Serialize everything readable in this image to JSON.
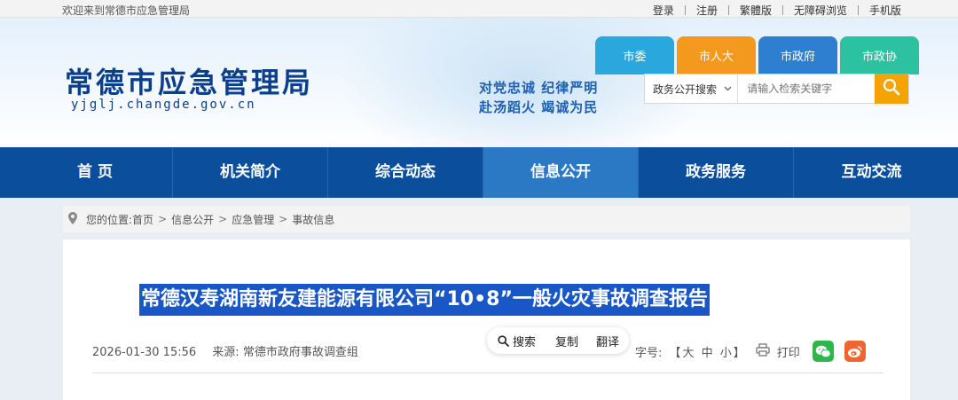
{
  "topbar": {
    "welcome": "欢迎来到常德市应急管理局",
    "links": [
      "登录",
      "注册",
      "繁體版",
      "无障碍浏览",
      "手机版"
    ]
  },
  "header": {
    "title": "常德市应急管理局",
    "url": "yjglj.changde.gov.cn",
    "slogan_line1": "对党忠诚 纪律严明",
    "slogan_line2": "赴汤蹈火 竭诚为民"
  },
  "gov_tabs": [
    {
      "label": "市委",
      "color": "#2aa7dc"
    },
    {
      "label": "市人大",
      "color": "#f39a1e"
    },
    {
      "label": "市政府",
      "color": "#2e7fd0"
    },
    {
      "label": "市政协",
      "color": "#2cc1a1"
    }
  ],
  "search": {
    "scope": "政务公开搜索",
    "placeholder": "请输入检索关键字",
    "button_icon": "search-icon"
  },
  "nav": {
    "items": [
      "首 页",
      "机关简介",
      "综合动态",
      "信息公开",
      "政务服务",
      "互动交流"
    ],
    "active_index": 3,
    "bg_color": "#0b4e9c",
    "active_color": "#2b78c4"
  },
  "breadcrumb": {
    "prefix": "您的位置:",
    "items": [
      "首页",
      "信息公开",
      "应急管理",
      "事故信息"
    ],
    "separator": ">"
  },
  "article": {
    "title": "常德汉寿湖南新友建能源有限公司“10•8”一般火灾事故调查报告",
    "date": "2026-01-30 15:56",
    "source_label": "来源:",
    "source": "常德市政府事故调查组",
    "highlight_color": "#1a57c6"
  },
  "selection_popup": {
    "search": "搜索",
    "copy": "复制",
    "translate": "翻译"
  },
  "tools": {
    "font_label": "字号:",
    "bracket_open": "【",
    "bracket_close": "】",
    "sizes": [
      "大",
      "中",
      "小"
    ],
    "print": "打印"
  },
  "share": {
    "wechat_icon": "wechat-icon",
    "weibo_icon": "weibo-icon"
  }
}
